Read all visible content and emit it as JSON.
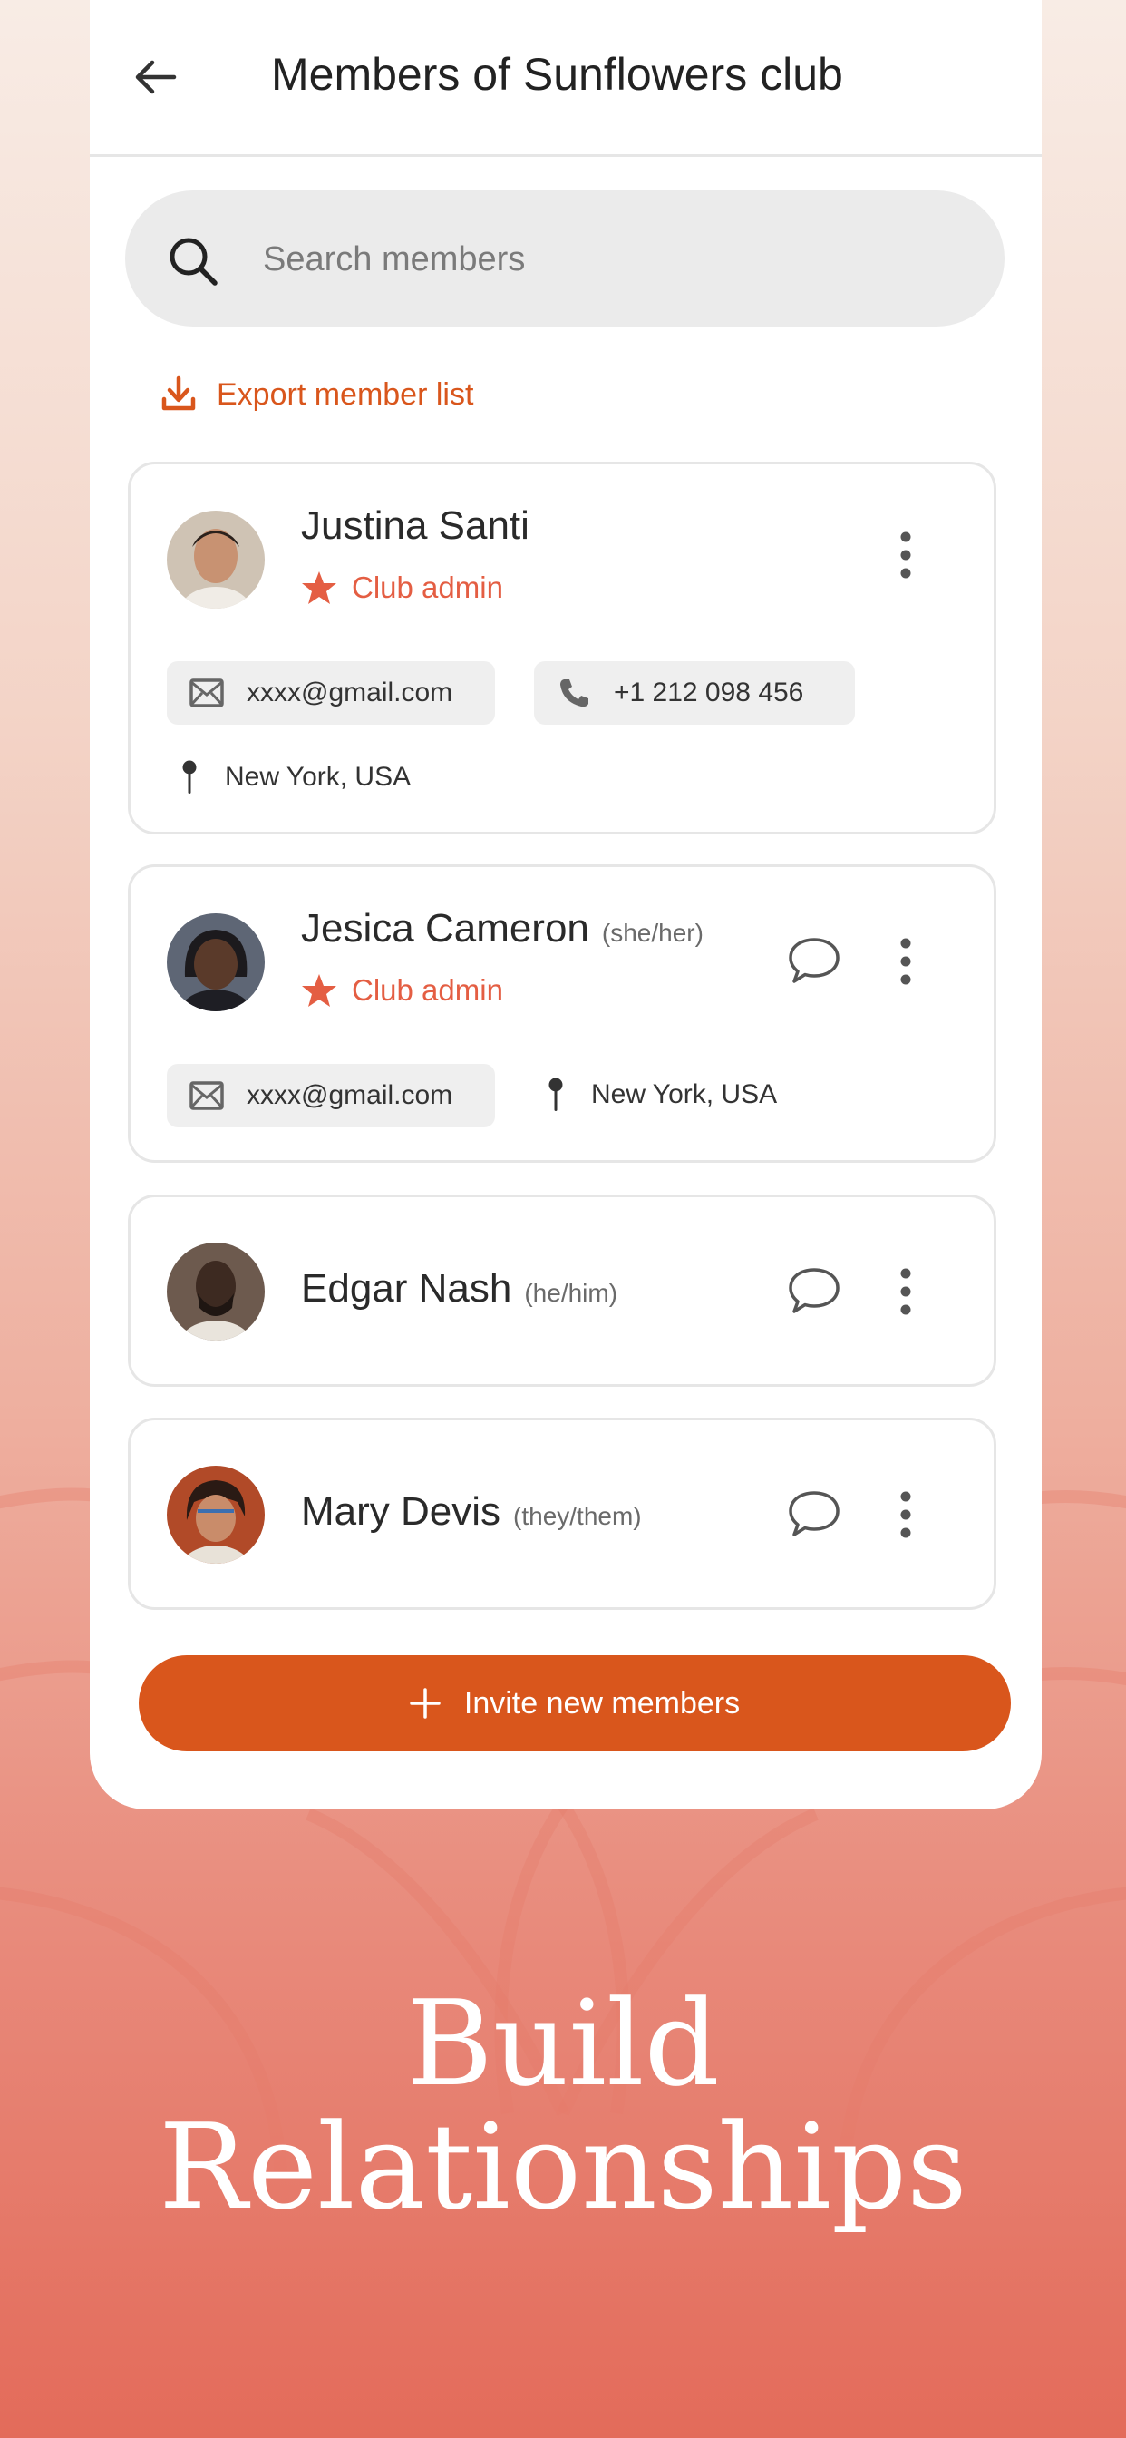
{
  "header": {
    "title": "Members of Sunflowers club"
  },
  "search": {
    "placeholder": "Search members"
  },
  "export": {
    "label": "Export member list"
  },
  "members": [
    {
      "name": "Justina Santi",
      "pronouns": "",
      "role": "Club admin",
      "email": "xxxx@gmail.com",
      "phone": "+1 212 098 456",
      "location": "New York, USA"
    },
    {
      "name": "Jesica Cameron",
      "pronouns": "(she/her)",
      "role": "Club admin",
      "email": "xxxx@gmail.com",
      "location": "New York, USA"
    },
    {
      "name": "Edgar Nash",
      "pronouns": "(he/him)"
    },
    {
      "name": "Mary Devis",
      "pronouns": "(they/them)"
    }
  ],
  "invite": {
    "label": "Invite new members"
  },
  "headline": {
    "line1": "Build",
    "line2": "Relationships"
  },
  "colors": {
    "accent": "#d9561c",
    "admin": "#e45e43",
    "background_top": "#f8ece5",
    "background_bottom": "#e36b5a"
  },
  "icons": [
    "arrow-left-icon",
    "search-icon",
    "download-icon",
    "star-icon",
    "mail-icon",
    "phone-icon",
    "pin-icon",
    "chat-bubble-icon",
    "more-vertical-icon",
    "plus-icon"
  ]
}
